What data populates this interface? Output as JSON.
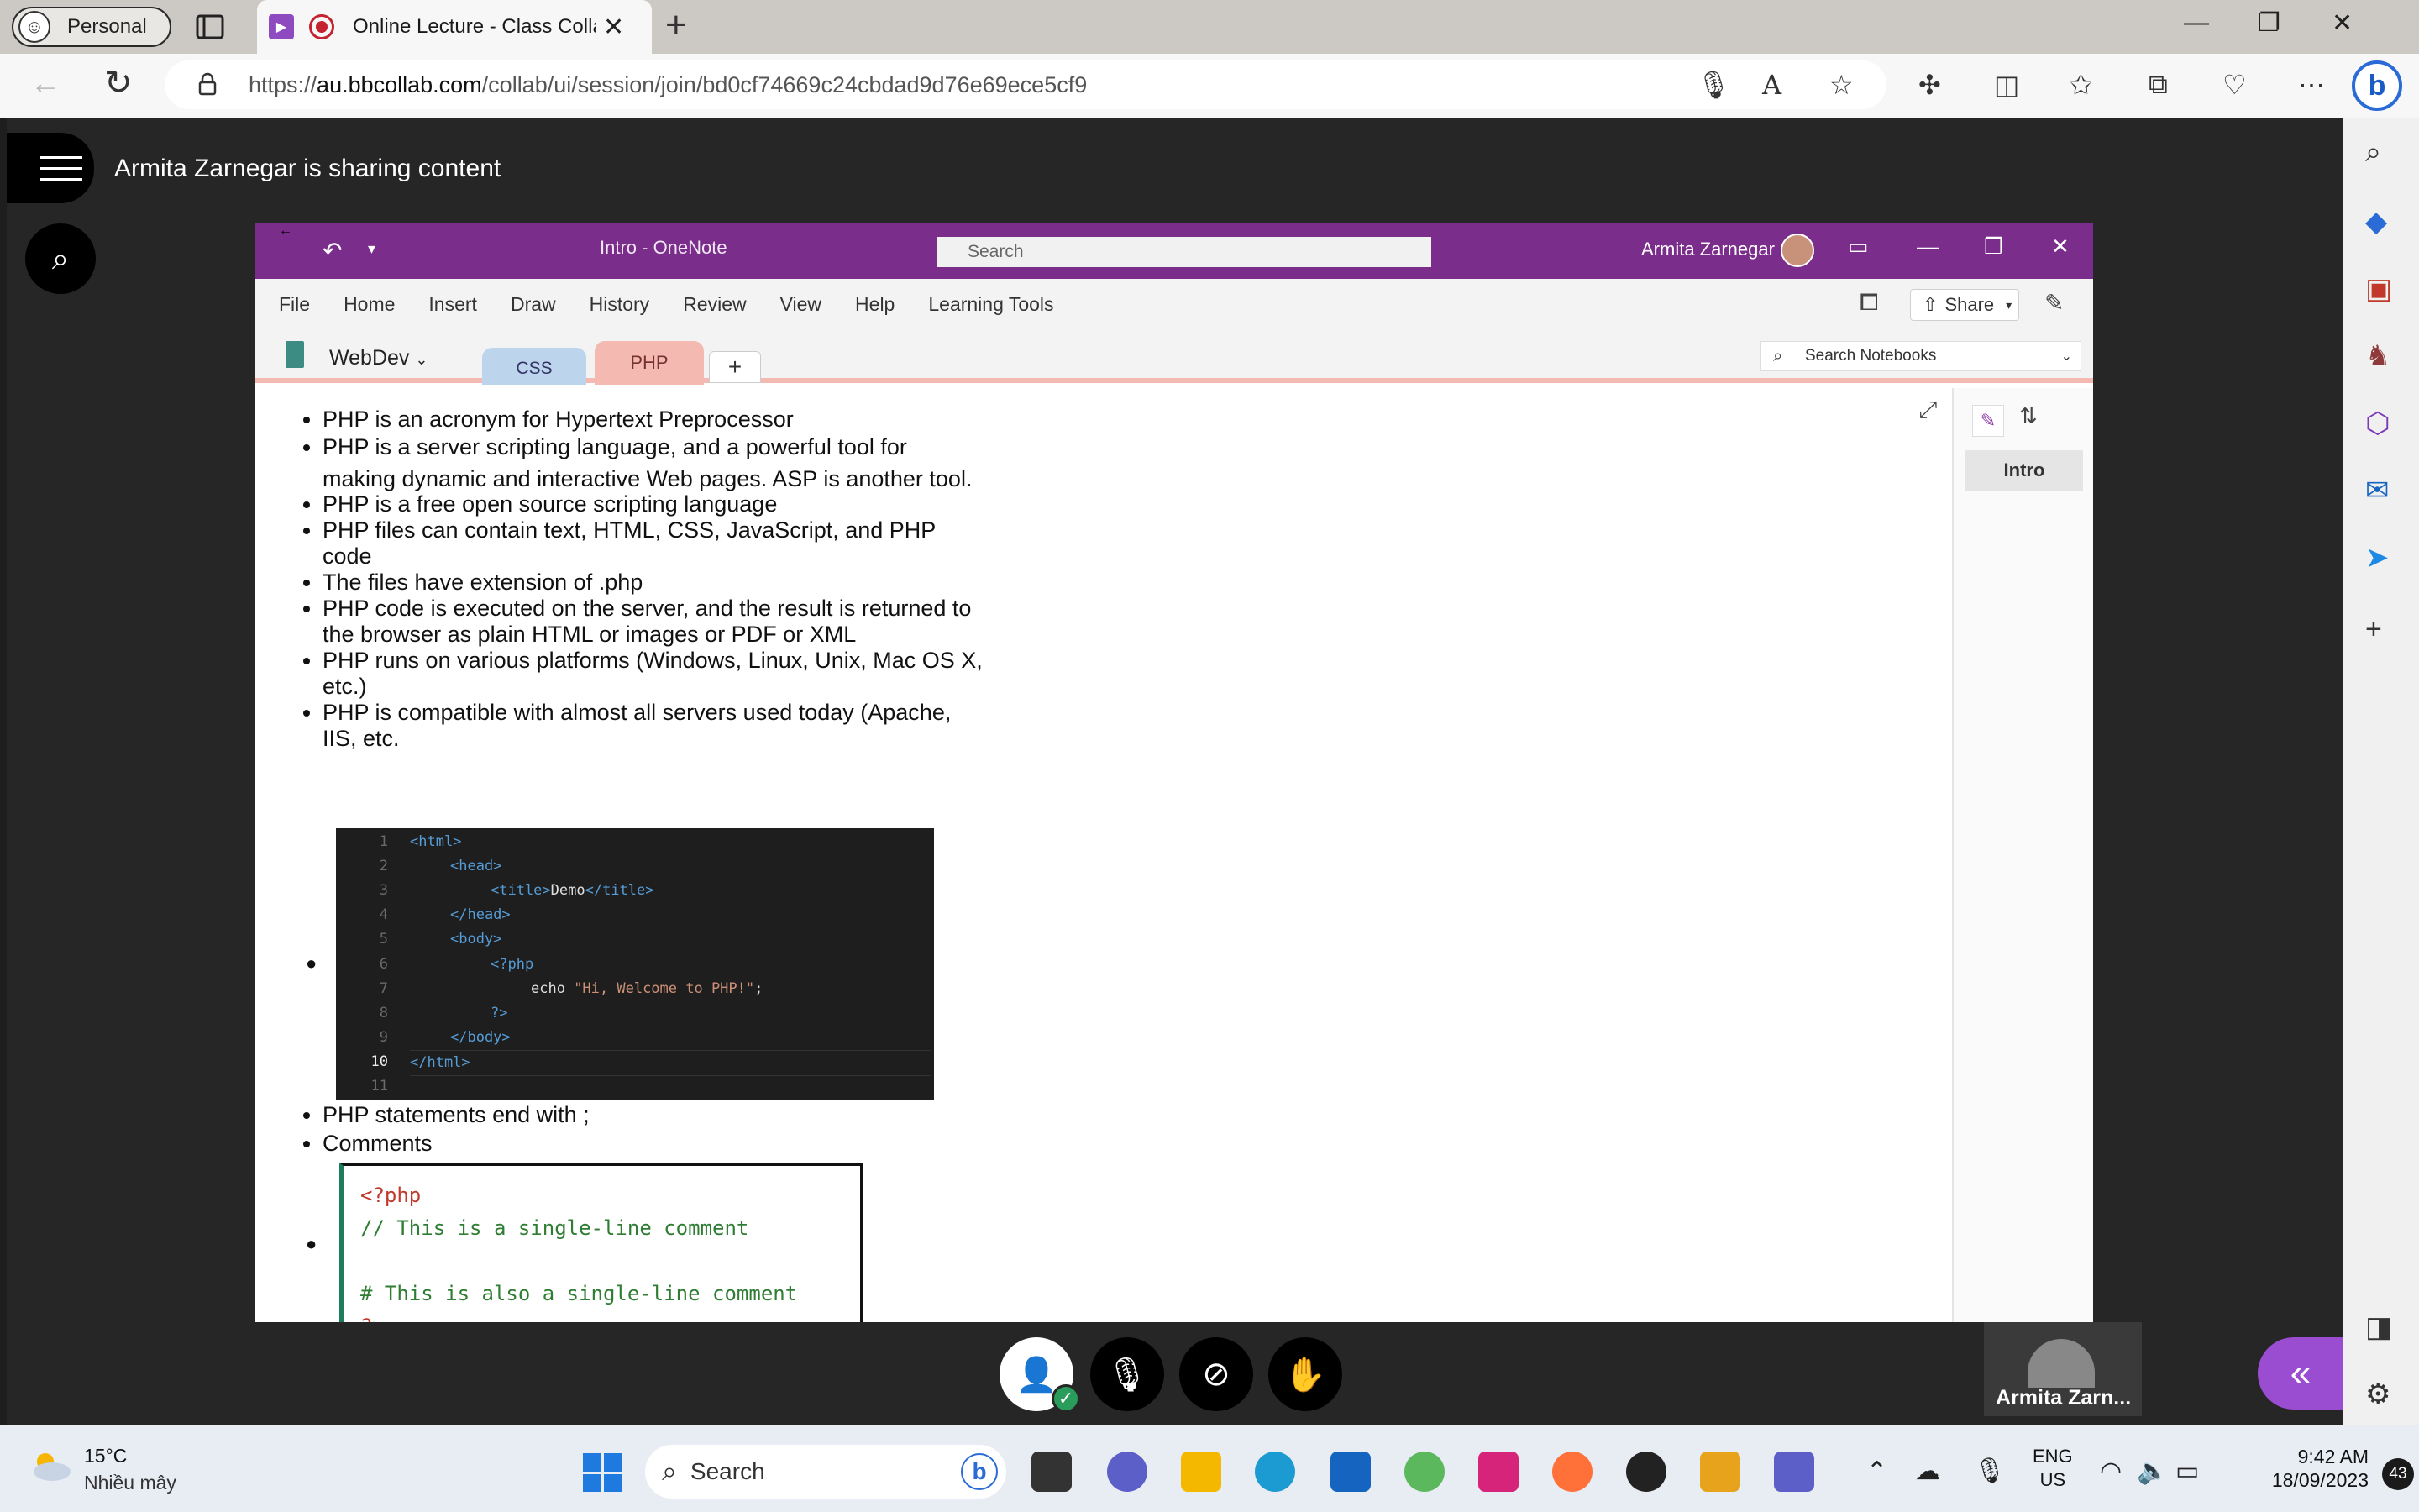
{
  "browser": {
    "profile_label": "Personal",
    "tab_title": "Online Lecture - Class Collab",
    "url_prefix": "https://",
    "url_domain": "au.bbcollab.com",
    "url_path": "/collab/ui/session/join/bd0cf74669c24cbdad9d76e69ece5cf9"
  },
  "session": {
    "sharing_text": "Armita Zarnegar is sharing content",
    "participant_name": "Armita Zarn..."
  },
  "onenote": {
    "doc_title": "Intro  -  OneNote",
    "search_placeholder": "Search",
    "user_name": "Armita Zarnegar",
    "ribbon": [
      "File",
      "Home",
      "Insert",
      "Draw",
      "History",
      "Review",
      "View",
      "Help",
      "Learning Tools"
    ],
    "share_label": "Share",
    "notebook_name": "WebDev",
    "sections": [
      "CSS",
      "PHP"
    ],
    "add_section": "+",
    "search_notebooks": "Search Notebooks",
    "page_title": "Intro"
  },
  "notes": {
    "bullets": [
      "PHP is an acronym for Hypertext Preprocessor",
      "PHP is a server scripting language, and a powerful tool for making dynamic and interactive Web pages. ASP is another tool.",
      "PHP is a free open source scripting language",
      "PHP files can contain text, HTML, CSS, JavaScript, and PHP code",
      "The files have extension of .php",
      "PHP code is executed on the server, and the result is returned to the browser as plain HTML or images or PDF or XML",
      "PHP runs on various platforms (Windows, Linux, Unix, Mac OS X, etc.)",
      "PHP is compatible with almost all servers used today (Apache, IIS, etc."
    ],
    "after_code": [
      "PHP statements end with ;",
      "Comments"
    ],
    "code_lines": [
      "1",
      "2",
      "3",
      "4",
      "5",
      "6",
      "7",
      "8",
      "9",
      "10",
      "11"
    ],
    "code": {
      "l1": "<html>",
      "l2": "<head>",
      "l3a": "<title>",
      "l3b": "Demo",
      "l3c": "</title>",
      "l4": "</head>",
      "l5": "<body>",
      "l6": "<?php",
      "l7a": "echo ",
      "l7b": "\"Hi, Welcome to PHP!\"",
      "l7c": ";",
      "l8": "?>",
      "l9": "</body>",
      "l10": "</html>"
    },
    "comment_code": [
      "<?php",
      "// This is a single-line comment",
      "",
      "# This is also a single-line comment",
      "?>"
    ]
  },
  "taskbar": {
    "temperature": "15°C",
    "weather": "Nhiều mây",
    "search_label": "Search",
    "lang_1": "ENG",
    "lang_2": "US",
    "time": "9:42 AM",
    "date": "18/09/2023",
    "notifications": "43"
  }
}
